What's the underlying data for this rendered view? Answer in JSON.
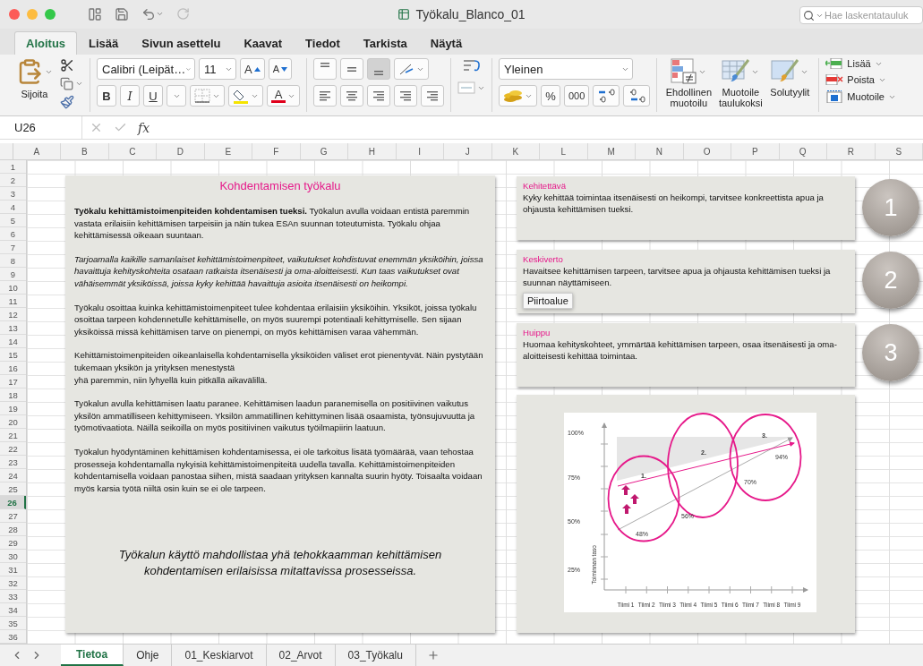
{
  "window": {
    "title": "Työkalu_Blanco_01"
  },
  "search": {
    "placeholder": "Hae laskentatauluk"
  },
  "ribbon_tabs": [
    {
      "label": "Aloitus",
      "selected": true
    },
    {
      "label": "Lisää",
      "selected": false
    },
    {
      "label": "Sivun asettelu",
      "selected": false
    },
    {
      "label": "Kaavat",
      "selected": false
    },
    {
      "label": "Tiedot",
      "selected": false
    },
    {
      "label": "Tarkista",
      "selected": false
    },
    {
      "label": "Näytä",
      "selected": false
    }
  ],
  "clipboard": {
    "paste_label": "Sijoita"
  },
  "font": {
    "name": "Calibri (Leipät…",
    "size": "11",
    "grow": "A",
    "shrink": "A",
    "bold": "B",
    "italic": "I",
    "underline": "U",
    "font_color": "A"
  },
  "vertical_align": [
    {
      "kind": "top",
      "selected": false
    },
    {
      "kind": "middle",
      "selected": false
    },
    {
      "kind": "bottom",
      "selected": true
    }
  ],
  "number": {
    "format": "Yleinen",
    "percent": "%",
    "thousands": "000"
  },
  "styles": [
    {
      "kind": "conditional",
      "label": "Ehdollinen muotoilu"
    },
    {
      "kind": "table",
      "label": "Muotoile taulukoksi"
    },
    {
      "kind": "cell",
      "label": "Solutyylit"
    }
  ],
  "cells": [
    {
      "kind": "insert",
      "label": "Lisää"
    },
    {
      "kind": "delete",
      "label": "Poista"
    },
    {
      "kind": "format",
      "label": "Muotoile"
    }
  ],
  "formula_bar": {
    "name_box": "U26",
    "fx": "fx"
  },
  "columns": [
    "A",
    "B",
    "C",
    "D",
    "E",
    "F",
    "G",
    "H",
    "I",
    "J",
    "K",
    "L",
    "M",
    "N",
    "O",
    "P",
    "Q",
    "R",
    "S"
  ],
  "rows": [
    {
      "label": "1",
      "selected": false
    },
    {
      "label": "2",
      "selected": false
    },
    {
      "label": "3",
      "selected": false
    },
    {
      "label": "4",
      "selected": false
    },
    {
      "label": "5",
      "selected": false
    },
    {
      "label": "6",
      "selected": false
    },
    {
      "label": "7",
      "selected": false
    },
    {
      "label": "8",
      "selected": false
    },
    {
      "label": "9",
      "selected": false
    },
    {
      "label": "10",
      "selected": false
    },
    {
      "label": "11",
      "selected": false
    },
    {
      "label": "12",
      "selected": false
    },
    {
      "label": "13",
      "selected": false
    },
    {
      "label": "14",
      "selected": false
    },
    {
      "label": "15",
      "selected": false
    },
    {
      "label": "16",
      "selected": false
    },
    {
      "label": "17",
      "selected": false
    },
    {
      "label": "18",
      "selected": false
    },
    {
      "label": "19",
      "selected": false
    },
    {
      "label": "20",
      "selected": false
    },
    {
      "label": "21",
      "selected": false
    },
    {
      "label": "22",
      "selected": false
    },
    {
      "label": "23",
      "selected": false
    },
    {
      "label": "24",
      "selected": false
    },
    {
      "label": "25",
      "selected": false
    },
    {
      "label": "26",
      "selected": true
    },
    {
      "label": "27",
      "selected": false
    },
    {
      "label": "28",
      "selected": false
    },
    {
      "label": "29",
      "selected": false
    },
    {
      "label": "30",
      "selected": false
    },
    {
      "label": "31",
      "selected": false
    },
    {
      "label": "32",
      "selected": false
    },
    {
      "label": "33",
      "selected": false
    },
    {
      "label": "34",
      "selected": false
    },
    {
      "label": "35",
      "selected": false
    },
    {
      "label": "36",
      "selected": false
    }
  ],
  "main_panel": {
    "title": "Kohdentamisen työkalu",
    "paragraphs": [
      {
        "text": "**Työkalu kehittämistoimenpiteiden kohdentamisen tueksi.** Työkalun avulla voidaan entistä paremmin vastata erilaisiin kehittämisen tarpeisiin ja näin tukea ESAn suunnan toteutumista. Työkalu ohjaa kehittämisessä oikeaan suuntaan."
      },
      {
        "text": "Tarjoamalla kaikille samanlaiset kehittämistoimenpiteet, vaikutukset kohdistuvat enemmän yksiköihin, joissa havaittuja kehityskohteita osataan ratkaista itsenäisesti ja oma-aloitteisesti. Kun taas vaikutukset ovat vähäisemmät yksiköissä, joissa kyky kehittää havaittuja asioita itsenäisesti on heikompi."
      },
      {
        "text": "Työkalu osoittaa kuinka kehittämistoimenpiteet tulee kohdentaa erilaisiin yksiköihin. Yksiköt, joissa työkalu osoittaa tarpeen kohdennetulle kehittämiselle, on myös suurempi potentiaali kehittymiselle. Sen sijaan yksiköissä missä kehittämisen tarve on pienempi, on myös kehittämisen varaa vähemmän."
      },
      {
        "text": "Kehittämistoimenpiteiden oikeanlaisella kohdentamisella yksiköiden väliset erot pienentyvät. Näin pystytään tukemaan yksikön ja yrityksen menestystä\nyhä paremmin, niin lyhyellä kuin pitkällä aikavälillä."
      },
      {
        "text": "Työkalun avulla kehittämisen laatu paranee. Kehittämisen laadun paranemisella on positiivinen vaikutus yksilön ammatilliseen kehittymiseen. Yksilön ammatillinen kehittyminen lisää osaamista, työnsujuvuutta ja työmotivaatiota. Näillä seikoilla on myös positiivinen vaikutus työilmapiirin laatuun."
      },
      {
        "text": "Työkalun hyödyntäminen kehittämisen kohdentamisessa, ei ole tarkoitus lisätä työmäärää, vaan tehostaa prosesseja kohdentamalla nykyisiä kehittämistoimenpiteitä uudella tavalla. Kehittämistoimenpiteiden kohdentamisella voidaan panostaa siihen, mistä saadaan yrityksen kannalta suurin hyöty. Toisaalta voidaan myös karsia työtä niiltä osin kuin se ei ole tarpeen."
      }
    ],
    "closing": "Työkalun käyttö mahdollistaa yhä tehokkaamman kehittämisen kohdentamisen erilaisissa mitattavissa prosesseissa."
  },
  "levels": [
    {
      "title": "Kehitettävä",
      "text": "Kyky kehittää toimintaa itsenäisesti on heikompi, tarvitsee konkreettista apua ja ohjausta kehittämisen tueksi.",
      "badge": "1"
    },
    {
      "title": "Keskiverto",
      "text": "Havaitsee kehittämisen tarpeen, tarvitsee apua ja ohjausta kehittämisen tueksi ja suunnan näyttämiseen.",
      "badge": "2",
      "tooltip": "Piirtoalue"
    },
    {
      "title": "Huippu",
      "text": "Huomaa kehityskohteet, ymmärtää kehittämisen tarpeen, osaa itsenäisesti ja oma-aloitteisesti kehittää toimintaa.",
      "badge": "3"
    }
  ],
  "diagram": {
    "y_labels": [
      "100%",
      "75%",
      "50%",
      "25%"
    ],
    "x_labels": [
      "Tiimi 1",
      "Tiimi 2",
      "Tiimi 3",
      "Tiimi 4",
      "Tiimi 5",
      "Tiimi 6",
      "Tiimi 7",
      "Tiimi 8",
      "Tiimi 9"
    ],
    "axis_title": "Toiminnan taso",
    "zone_labels": [
      "1.",
      "2.",
      "3."
    ],
    "point_labels": [
      "48%",
      "56%",
      "70%",
      "94%"
    ]
  },
  "sheet_tabs": [
    {
      "label": "Tietoa",
      "selected": true
    },
    {
      "label": "Ohje",
      "selected": false
    },
    {
      "label": "01_Keskiarvot",
      "selected": false
    },
    {
      "label": "02_Arvot",
      "selected": false
    },
    {
      "label": "03_Työkalu",
      "selected": false
    }
  ]
}
